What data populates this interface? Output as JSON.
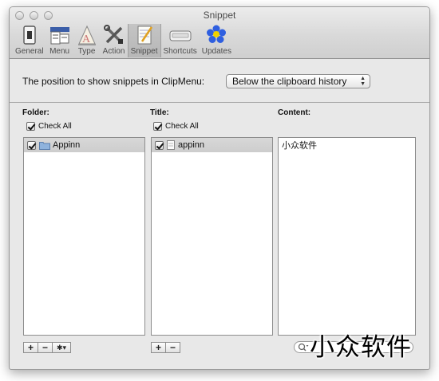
{
  "window": {
    "title": "Snippet"
  },
  "toolbar": {
    "items": [
      {
        "label": "General",
        "icon": "switch-icon"
      },
      {
        "label": "Menu",
        "icon": "menu-icon"
      },
      {
        "label": "Type",
        "icon": "type-icon"
      },
      {
        "label": "Action",
        "icon": "tools-icon"
      },
      {
        "label": "Snippet",
        "icon": "notepad-icon",
        "selected": true
      },
      {
        "label": "Shortcuts",
        "icon": "keyboard-icon"
      },
      {
        "label": "Updates",
        "icon": "updates-icon"
      }
    ]
  },
  "position": {
    "label": "The position to show snippets in ClipMenu:",
    "selected": "Below the clipboard history"
  },
  "folder": {
    "header": "Folder:",
    "check_all": "Check All",
    "items": [
      {
        "name": "Appinn",
        "checked": true
      }
    ]
  },
  "title": {
    "header": "Title:",
    "check_all": "Check All",
    "items": [
      {
        "name": "appinn",
        "checked": true
      }
    ]
  },
  "content": {
    "header": "Content:",
    "text": "小众软件"
  },
  "buttons": {
    "add": "+",
    "remove": "−",
    "gear": "✱▾"
  },
  "watermark": "小众软件",
  "colors": {
    "selected_row": "#d3d3d3",
    "folder_blue": "#8fb3dd",
    "updates_blue": "#2f5fe0",
    "updates_yellow": "#f0d000"
  }
}
